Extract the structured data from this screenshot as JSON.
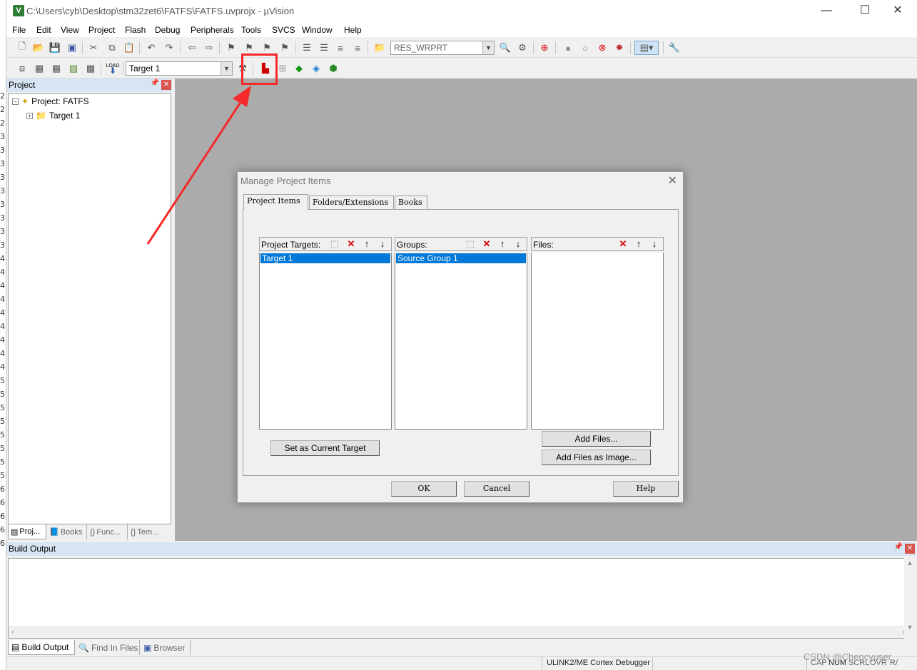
{
  "window": {
    "title": "C:\\Users\\cyb\\Desktop\\stm32zet6\\FATFS\\FATFS.uvprojx - µVision",
    "minimize": "—",
    "maximize": "☐",
    "close": "✕"
  },
  "menu": [
    "File",
    "Edit",
    "View",
    "Project",
    "Flash",
    "Debug",
    "Peripherals",
    "Tools",
    "SVCS",
    "Window",
    "Help"
  ],
  "toolbar": {
    "find_combo_value": "RES_WRPRT",
    "target_combo_value": "Target 1",
    "load_label": "LOAD"
  },
  "project_panel": {
    "header": "Project",
    "root": "Project: FATFS",
    "target": "Target 1",
    "tabs": [
      "Proj...",
      "Books",
      "Func...",
      "Tem..."
    ]
  },
  "build_output": {
    "header": "Build Output",
    "tabs": [
      "Build Output",
      "Find In Files",
      "Browser"
    ]
  },
  "status_bar": {
    "debugger": "ULINK2/ME Cortex Debugger",
    "indicators": [
      "CAP",
      "NUM",
      "SCRL",
      "OVR",
      "R/"
    ]
  },
  "watermark": "CSDN @Chencyuser",
  "dialog": {
    "title": "Manage Project Items",
    "tabs": [
      "Project Items",
      "Folders/Extensions",
      "Books"
    ],
    "targets_label": "Project Targets:",
    "targets": [
      "Target 1"
    ],
    "groups_label": "Groups:",
    "groups": [
      "Source Group 1"
    ],
    "files_label": "Files:",
    "set_current_target": "Set as Current Target",
    "add_files": "Add Files...",
    "add_files_image": "Add Files as Image...",
    "ok": "OK",
    "cancel": "Cancel",
    "help": "Help"
  },
  "left_strip_numbers": [
    "2",
    "2",
    "2",
    "3",
    "3",
    "3",
    "3",
    "3",
    "3",
    "3",
    "3",
    "3",
    "4",
    "4",
    "4",
    "4",
    "4",
    "4",
    "4",
    "4",
    "4",
    "5",
    "5",
    "5",
    "5",
    "5",
    "5",
    "5",
    "5",
    "6",
    "6",
    "6",
    "6",
    "6"
  ],
  "colors": {
    "selection": "#0078d7",
    "annotation": "#f52a2a",
    "editor_bg": "#ababab",
    "panel_header": "#d7e4f2"
  }
}
